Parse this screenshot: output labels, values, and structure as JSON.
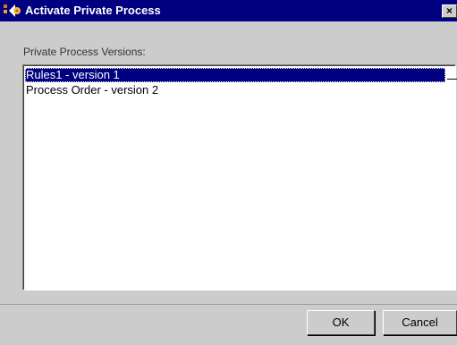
{
  "window": {
    "title": "Activate Private Process",
    "close_glyph": "×"
  },
  "icons": {
    "app": "process-gear-icon",
    "close": "close-icon"
  },
  "versions_section": {
    "label": "Private Process Versions:",
    "items": [
      {
        "label": "Rules1 - version 1",
        "selected": true
      },
      {
        "label": "Process Order - version 2",
        "selected": false
      }
    ]
  },
  "buttons": {
    "ok": "OK",
    "cancel": "Cancel"
  },
  "colors": {
    "titlebar": "#000080",
    "selection": "#000080",
    "dialog_bg": "#cccccc"
  }
}
